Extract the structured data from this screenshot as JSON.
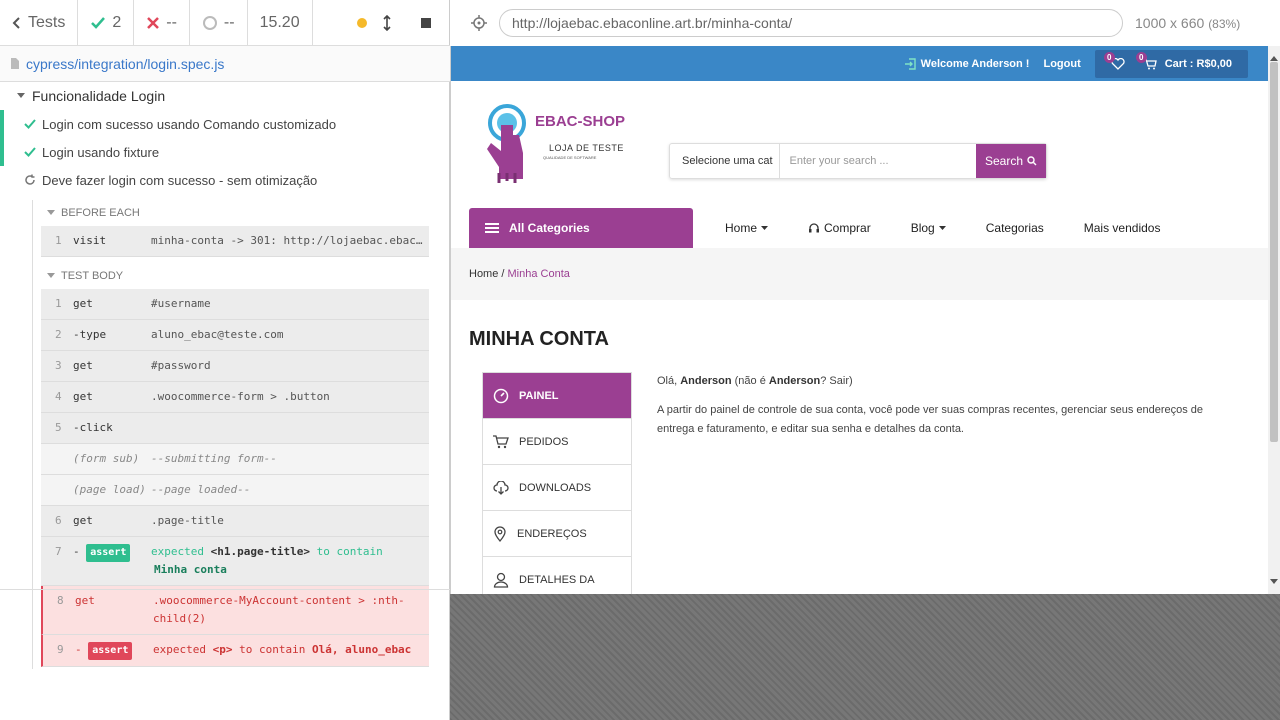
{
  "runner": {
    "tests_label": "Tests",
    "passed": "2",
    "failed": "--",
    "pending": "--",
    "duration": "15.20",
    "spec_path": "cypress/integration/login.spec.js",
    "suite_title": "Funcionalidade Login",
    "tests": [
      {
        "title": "Login com sucesso usando Comando customizado",
        "state": "passed"
      },
      {
        "title": "Login usando fixture",
        "state": "passed"
      },
      {
        "title": "Deve fazer login com sucesso - sem otimização",
        "state": "running"
      }
    ],
    "before_each_label": "BEFORE EACH",
    "test_body_label": "TEST BODY",
    "before_each_cmds": [
      {
        "n": "1",
        "name": "visit",
        "msg": "minha-conta -> 301: http://lojaebac.ebac…"
      }
    ],
    "body_cmds": [
      {
        "n": "1",
        "name": "get",
        "msg": "#username"
      },
      {
        "n": "2",
        "name": "-type",
        "msg": "aluno_ebac@teste.com"
      },
      {
        "n": "3",
        "name": "get",
        "msg": "#password"
      },
      {
        "n": "4",
        "name": "get",
        "msg": ".woocommerce-form > .button"
      },
      {
        "n": "5",
        "name": "-click",
        "msg": ""
      },
      {
        "n": "",
        "name": "(form sub)",
        "msg": "--submitting form--"
      },
      {
        "n": "",
        "name": "(page load)",
        "msg": "--page loaded--"
      },
      {
        "n": "6",
        "name": "get",
        "msg": ".page-title"
      },
      {
        "n": "7",
        "name": "-assert",
        "msg_pre": "expected",
        "msg_el": "<h1.page-title>",
        "msg_mid": "to contain",
        "msg_val": "Minha conta"
      },
      {
        "n": "8",
        "name": "get",
        "msg": ".woocommerce-MyAccount-content > :nth-child(2)"
      },
      {
        "n": "9",
        "name": "-assert",
        "msg_pre": "expected",
        "msg_el": "<p>",
        "msg_mid": "to contain",
        "msg_val": "Olá, aluno_ebac"
      }
    ]
  },
  "browser": {
    "url": "http://lojaebac.ebaconline.art.br/minha-conta/",
    "viewport": "1000 x 660",
    "zoom": "(83%)"
  },
  "site": {
    "welcome": "Welcome Anderson !",
    "logout": "Logout",
    "wishlist_count": "0",
    "cart_count": "0",
    "cart_label": "Cart : R$0,00",
    "logo_title": "EBAC-SHOP",
    "logo_sub": "LOJA DE TESTE",
    "logo_sub2": "QUALIDADE DE SOFTWARE",
    "search_category": "Selecione uma cat",
    "search_placeholder": "Enter your search ...",
    "search_button": "Search",
    "all_categories": "All Categories",
    "menu": [
      "Home",
      "Comprar",
      "Blog",
      "Categorias",
      "Mais vendidos"
    ],
    "breadcrumb_home": "Home",
    "breadcrumb_sep": " / ",
    "breadcrumb_current": "Minha Conta",
    "page_title": "MINHA CONTA",
    "account_nav": [
      "PAINEL",
      "PEDIDOS",
      "DOWNLOADS",
      "ENDEREÇOS",
      "DETALHES DA"
    ],
    "greeting_pre": "Olá, ",
    "greeting_name": "Anderson",
    "greeting_mid": " (não é ",
    "greeting_name2": "Anderson",
    "greeting_q": "? ",
    "greeting_logout": "Sair",
    "greeting_end": ")",
    "dashboard_text": "A partir do painel de controle de sua conta, você pode ver suas compras recentes, gerenciar seus endereços de entrega e faturamento, e editar sua senha e detalhes da conta."
  },
  "colors": {
    "brand_purple": "#9b3f92",
    "topbar_blue": "#3a87c7",
    "pass_green": "#2fbe8f",
    "fail_red": "#e0475a"
  }
}
